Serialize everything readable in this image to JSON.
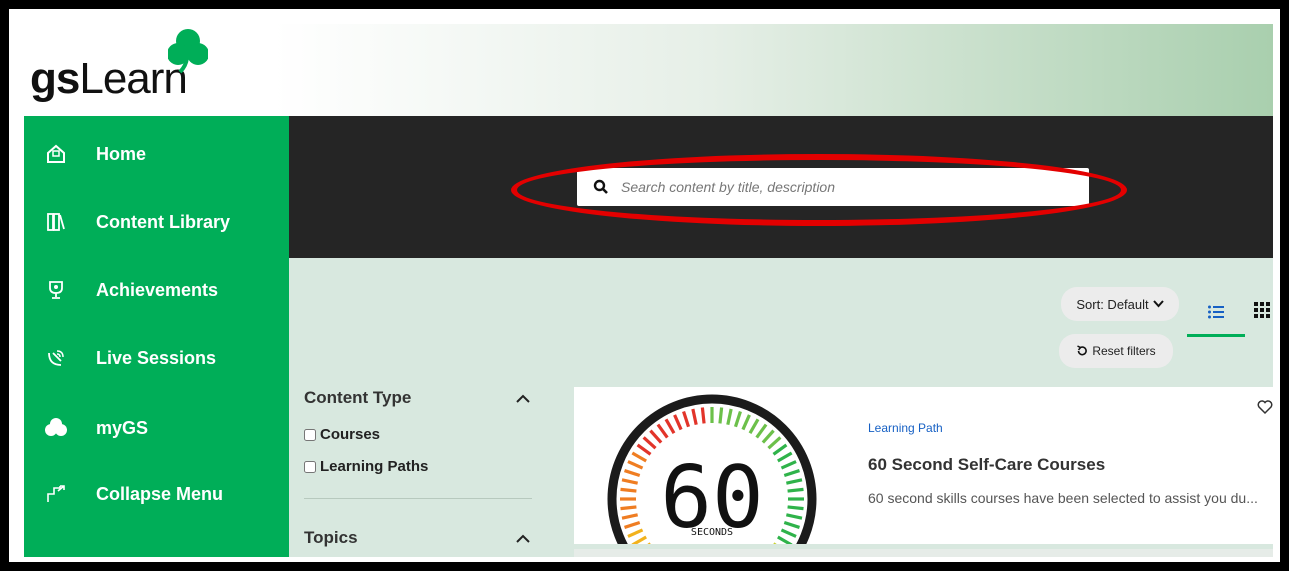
{
  "brand": {
    "logo_bold": "gs",
    "logo_rest": "Learn"
  },
  "sidebar": {
    "items": [
      {
        "label": "Home",
        "icon": "home-icon"
      },
      {
        "label": "Content Library",
        "icon": "library-icon"
      },
      {
        "label": "Achievements",
        "icon": "trophy-icon"
      },
      {
        "label": "Live Sessions",
        "icon": "satellite-icon"
      },
      {
        "label": "myGS",
        "icon": "clover-icon"
      },
      {
        "label": "Collapse Menu",
        "icon": "collapse-icon"
      }
    ]
  },
  "search": {
    "placeholder": "Search content by title, description"
  },
  "toolbar": {
    "sort_label": "Sort: Default",
    "reset_label": "Reset filters",
    "list_view_icon": "list-view-icon",
    "grid_view_icon": "grid-view-icon"
  },
  "filters": {
    "content_type": {
      "title": "Content Type",
      "options": [
        "Courses",
        "Learning Paths"
      ]
    },
    "topics": {
      "title": "Topics"
    }
  },
  "results": [
    {
      "type": "Learning Path",
      "title": "60 Second Self-Care Courses",
      "description": "60 second skills courses have been selected to assist you du...",
      "thumb_number": "60",
      "thumb_caption": "SECONDS"
    }
  ],
  "colors": {
    "sidebar_green": "#00ae58",
    "search_band": "#252525",
    "highlight_ring": "#e30000",
    "link_blue": "#1660c4"
  }
}
